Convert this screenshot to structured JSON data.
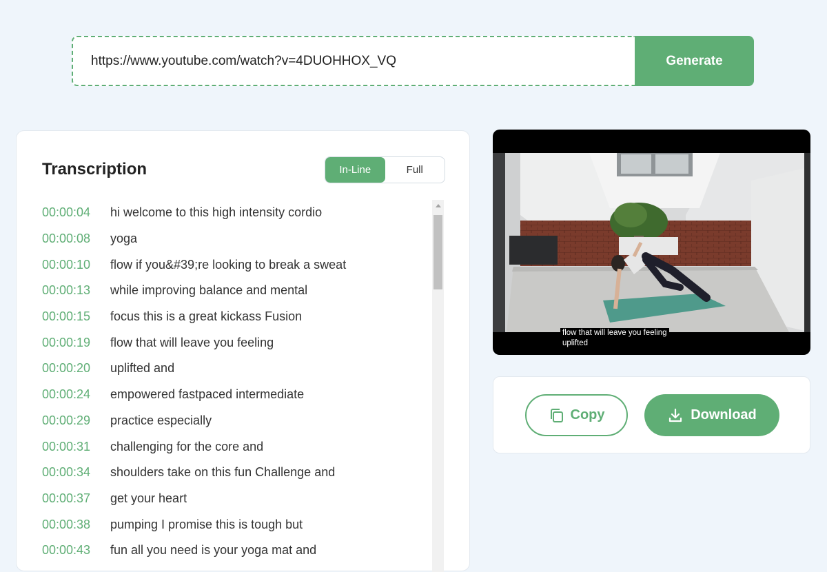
{
  "url_bar": {
    "value": "https://www.youtube.com/watch?v=4DUOHHOX_VQ",
    "generate_label": "Generate"
  },
  "transcription": {
    "title": "Transcription",
    "toggle": {
      "inline_label": "In-Line",
      "full_label": "Full",
      "selected": "In-Line"
    },
    "rows": [
      {
        "time": "00:00:04",
        "text": "hi welcome to this high intensity cordio"
      },
      {
        "time": "00:00:08",
        "text": "yoga"
      },
      {
        "time": "00:00:10",
        "text": "flow if you&#39;re looking to break a sweat"
      },
      {
        "time": "00:00:13",
        "text": "while improving balance and mental"
      },
      {
        "time": "00:00:15",
        "text": "focus this is a great kickass Fusion"
      },
      {
        "time": "00:00:19",
        "text": "flow that will leave you feeling"
      },
      {
        "time": "00:00:20",
        "text": "uplifted and"
      },
      {
        "time": "00:00:24",
        "text": "empowered fastpaced intermediate"
      },
      {
        "time": "00:00:29",
        "text": "practice especially"
      },
      {
        "time": "00:00:31",
        "text": "challenging for the core and"
      },
      {
        "time": "00:00:34",
        "text": "shoulders take on this fun Challenge and"
      },
      {
        "time": "00:00:37",
        "text": "get your heart"
      },
      {
        "time": "00:00:38",
        "text": "pumping I promise this is tough but"
      },
      {
        "time": "00:00:43",
        "text": "fun all you need is your yoga mat and"
      }
    ]
  },
  "video": {
    "caption_line1": "flow that will leave you feeling",
    "caption_line2": "uplifted"
  },
  "actions": {
    "copy_label": "Copy",
    "download_label": "Download"
  },
  "colors": {
    "accent": "#5fae75",
    "background": "#eff5fb"
  }
}
